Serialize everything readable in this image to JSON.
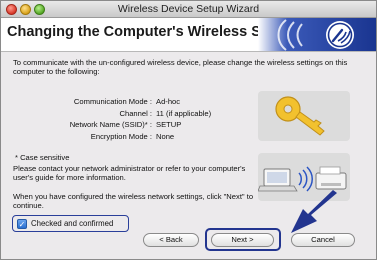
{
  "window": {
    "title": "Wireless Device Setup Wizard"
  },
  "banner": {
    "title": "Changing the Computer's Wireless Settings",
    "brand_color": "#1f3c9c"
  },
  "intro_text": "To communicate with the un-configured wireless device, please change the wireless settings on this computer to the following:",
  "settings": [
    {
      "label": "Communication Mode :",
      "value": "Ad-hoc"
    },
    {
      "label": "Channel :",
      "value": "11  (if applicable)"
    },
    {
      "label": "Network Name (SSID)* :",
      "value": "SETUP"
    },
    {
      "label": "Encryption Mode :",
      "value": "None"
    }
  ],
  "note": "* Case sensitive",
  "contact_text": "Please contact your network administrator or refer to your computer's user's guide for more information.",
  "when_text": "When you have configured the wireless network settings, click \"Next\" to continue.",
  "checkbox": {
    "label": "Checked and confirmed",
    "checked": true,
    "mark": "✓"
  },
  "buttons": {
    "back": "< Back",
    "next": "Next >",
    "cancel": "Cancel"
  },
  "icons": {
    "key": "key-icon",
    "laptop_printer": "laptop-printer-wireless-icon",
    "wireless_brand": "wireless-logo-icon",
    "arrow": "pointer-arrow-icon"
  }
}
